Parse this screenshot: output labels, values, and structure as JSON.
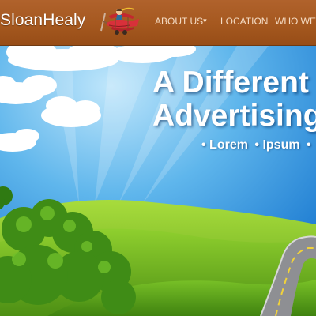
{
  "header": {
    "logo_text": "SloanHealy",
    "nav": [
      {
        "label": "ABOUT US",
        "has_dropdown": true
      },
      {
        "label": "LOCATION"
      },
      {
        "label": "WHO WE A"
      }
    ]
  },
  "hero": {
    "heading_line1": "A Different K",
    "heading_line2": "Advertising ",
    "bullets": [
      "• Lorem",
      "• Ipsum",
      "•"
    ]
  },
  "colors": {
    "header_bg": "#a5581f",
    "nav_text": "#f5dcc4",
    "sky": "#1f8ad8",
    "grass": "#7cc223"
  },
  "icons": {
    "nav_dropdown": "caret-down-icon",
    "logo_art": "airplane-icon"
  }
}
